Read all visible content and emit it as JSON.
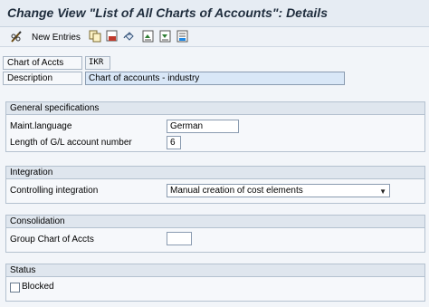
{
  "window": {
    "title": "Change View \"List of All Charts of Accounts\": Details"
  },
  "toolbar": {
    "items": [
      {
        "icon": "pencil-glasses-icon",
        "label": "New Entries"
      },
      {
        "icon": "copy-icon"
      },
      {
        "icon": "delete-icon"
      },
      {
        "icon": "undo-icon"
      },
      {
        "icon": "previous-entry-icon"
      },
      {
        "icon": "next-entry-icon"
      },
      {
        "icon": "select-icon"
      }
    ]
  },
  "header": {
    "chart_label": "Chart of Accts",
    "chart_value": "IKR",
    "description_label": "Description",
    "description_value": "Chart of accounts - industry"
  },
  "general": {
    "title": "General specifications",
    "language_label": "Maint.language",
    "language_value": "German",
    "length_label": "Length of G/L account number",
    "length_value": "6"
  },
  "integration": {
    "title": "Integration",
    "controlling_label": "Controlling integration",
    "controlling_value": "Manual creation of cost elements"
  },
  "consolidation": {
    "title": "Consolidation",
    "group_label": "Group Chart of Accts",
    "group_value": ""
  },
  "status": {
    "title": "Status",
    "blocked_label": "Blocked",
    "blocked_checked": false
  }
}
